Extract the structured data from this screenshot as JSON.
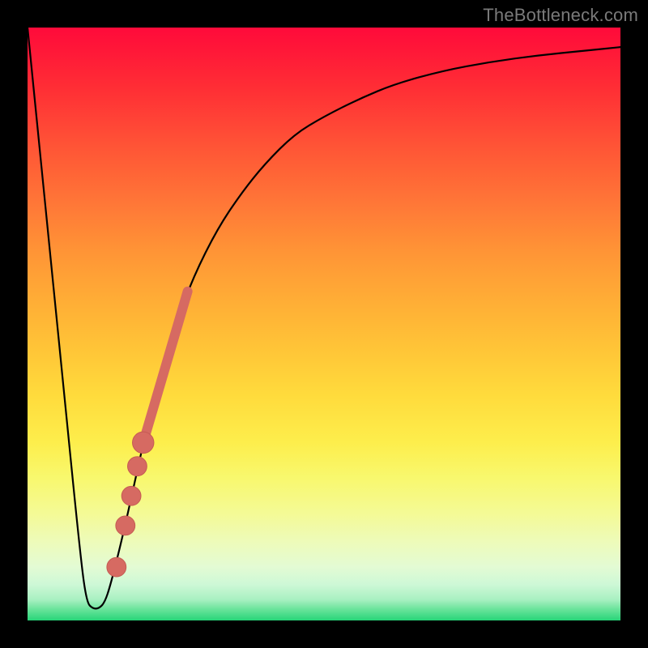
{
  "watermark": "TheBottleneck.com",
  "colors": {
    "frame": "#000000",
    "curve": "#000000",
    "marker": "#d66a62",
    "marker_stroke": "#c55b53"
  },
  "chart_data": {
    "type": "line",
    "title": "",
    "xlabel": "",
    "ylabel": "",
    "xlim": [
      0,
      100
    ],
    "ylim": [
      0,
      100
    ],
    "series": [
      {
        "name": "curve",
        "x": [
          0,
          3,
          6,
          9,
          10,
          11,
          12,
          13,
          14,
          16,
          18,
          20,
          22,
          25,
          28,
          32,
          36,
          40,
          45,
          50,
          56,
          62,
          70,
          78,
          86,
          94,
          100
        ],
        "y": [
          100,
          70,
          40,
          10,
          3,
          2,
          2,
          3,
          6,
          14,
          23,
          32,
          40,
          50,
          58,
          66,
          72,
          77,
          82,
          85,
          88,
          90.5,
          92.7,
          94.2,
          95.3,
          96.1,
          96.7
        ]
      }
    ],
    "markers": [
      {
        "x": 15.0,
        "y": 9,
        "r": 1.2
      },
      {
        "x": 16.5,
        "y": 16,
        "r": 1.2
      },
      {
        "x": 17.5,
        "y": 21,
        "r": 1.2
      },
      {
        "x": 18.5,
        "y": 26,
        "r": 1.2
      },
      {
        "x": 19.5,
        "y": 30,
        "r": 1.4
      }
    ],
    "thick_segment": {
      "x": [
        19.5,
        27.0
      ],
      "y": [
        30.0,
        55.5
      ]
    },
    "annotations": []
  }
}
